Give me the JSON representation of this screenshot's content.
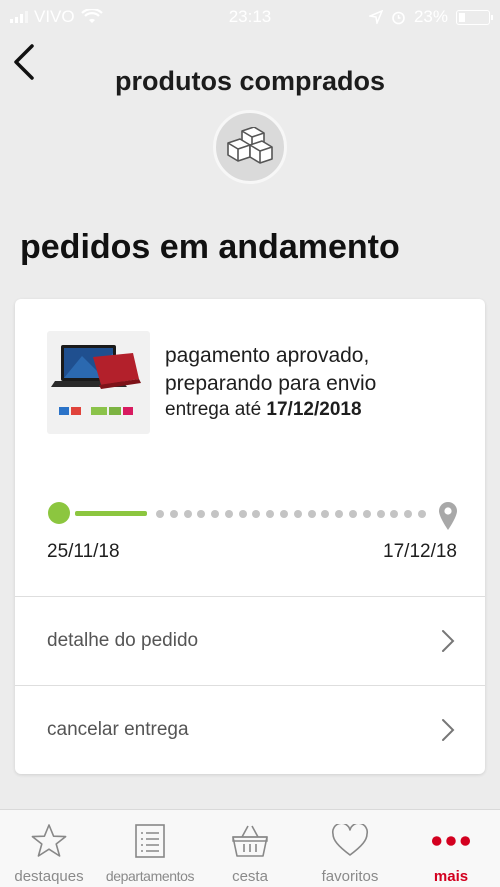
{
  "status_bar": {
    "carrier": "VIVO",
    "time": "23:13",
    "battery": "23%"
  },
  "header": {
    "title": "produtos comprados",
    "icon": "boxes-icon"
  },
  "section": {
    "title": "pedidos em andamento"
  },
  "order": {
    "status": "pagamento aprovado, preparando para envio",
    "delivery_prefix": "entrega até",
    "delivery_date": "17/12/2018",
    "progress_fraction": 0.25,
    "start_date": "25/11/18",
    "end_date": "17/12/18",
    "actions": [
      {
        "label": "detalhe do pedido"
      },
      {
        "label": "cancelar entrega"
      }
    ]
  },
  "tabbar": {
    "items": [
      {
        "label": "destaques",
        "icon": "star-icon"
      },
      {
        "label": "departamentos",
        "icon": "list-icon"
      },
      {
        "label": "cesta",
        "icon": "basket-icon"
      },
      {
        "label": "favoritos",
        "icon": "heart-icon"
      },
      {
        "label": "mais",
        "icon": "more-dots-icon",
        "active": true
      }
    ]
  },
  "colors": {
    "accent": "#d3001f",
    "progress": "#8cc63f",
    "background": "#ececec"
  }
}
